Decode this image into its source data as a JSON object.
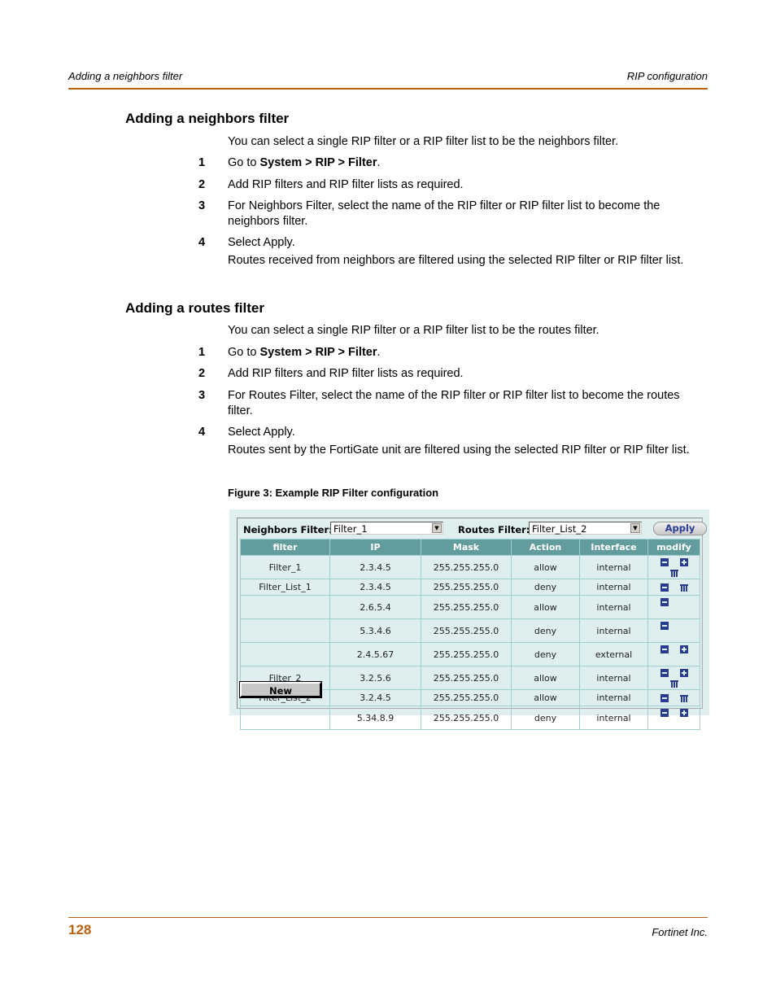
{
  "header": {
    "left": "Adding a neighbors filter",
    "right": "RIP configuration"
  },
  "sections": [
    {
      "title": "Adding a neighbors filter",
      "intro": "You can select a single RIP filter or a RIP filter list to be the neighbors filter.",
      "steps": [
        {
          "num": "1",
          "pre": "Go to ",
          "bold": "System > RIP > Filter",
          "post": "."
        },
        {
          "num": "2",
          "text": "Add RIP filters and RIP filter lists as required."
        },
        {
          "num": "3",
          "text": "For Neighbors Filter, select the name of the RIP filter or RIP filter list to become the neighbors filter."
        },
        {
          "num": "4",
          "text": "Select Apply.",
          "note": "Routes received from neighbors are filtered using the selected RIP filter or RIP filter list."
        }
      ]
    },
    {
      "title": "Adding a routes filter",
      "intro": "You can select a single RIP filter or a RIP filter list to be the routes filter.",
      "steps": [
        {
          "num": "1",
          "pre": "Go to ",
          "bold": "System > RIP > Filter",
          "post": "."
        },
        {
          "num": "2",
          "text": "Add RIP filters and RIP filter lists as required."
        },
        {
          "num": "3",
          "text": "For Routes Filter, select the name of the RIP filter or RIP filter list to become the routes filter."
        },
        {
          "num": "4",
          "text": "Select Apply.",
          "note": "Routes sent by the FortiGate unit are filtered using the selected RIP filter or RIP filter list."
        }
      ]
    }
  ],
  "figure": {
    "caption": "Figure 3:   Example RIP Filter configuration",
    "neighbors_label": "Neighbors Filter:",
    "neighbors_value": "Filter_1",
    "routes_label": "Routes Filter:",
    "routes_value": "Filter_List_2",
    "apply_label": "Apply",
    "new_label": "New",
    "columns": [
      "filter",
      "IP",
      "Mask",
      "Action",
      "Interface",
      "modify"
    ],
    "rows": [
      {
        "filter": "Filter_1",
        "ip": "2.3.4.5",
        "mask": "255.255.255.0",
        "action": "allow",
        "iface": "internal",
        "icons": [
          "collapse-icon",
          "add-icon",
          "delete-icon"
        ]
      },
      {
        "filter": "Filter_List_1",
        "ip": "2.3.4.5",
        "mask": "255.255.255.0",
        "action": "deny",
        "iface": "internal",
        "icons": [
          "collapse-icon",
          "delete-icon"
        ]
      },
      {
        "filter": "",
        "ip": "2.6.5.4",
        "mask": "255.255.255.0",
        "action": "allow",
        "iface": "internal",
        "icons": [
          "collapse-icon"
        ]
      },
      {
        "filter": "",
        "ip": "5.3.4.6",
        "mask": "255.255.255.0",
        "action": "deny",
        "iface": "internal",
        "icons": [
          "collapse-icon"
        ]
      },
      {
        "filter": "",
        "ip": "2.4.5.67",
        "mask": "255.255.255.0",
        "action": "deny",
        "iface": "external",
        "icons": [
          "collapse-icon",
          "add-icon"
        ]
      },
      {
        "filter": "Filter_2",
        "ip": "3.2.5.6",
        "mask": "255.255.255.0",
        "action": "allow",
        "iface": "internal",
        "icons": [
          "collapse-icon",
          "add-icon",
          "delete-icon"
        ]
      },
      {
        "filter": "Filter_List_2",
        "ip": "3.2.4.5",
        "mask": "255.255.255.0",
        "action": "allow",
        "iface": "internal",
        "icons": [
          "collapse-icon",
          "delete-icon"
        ]
      },
      {
        "filter": "",
        "ip": "5.34.8.9",
        "mask": "255.255.255.0",
        "action": "deny",
        "iface": "internal",
        "icons": [
          "collapse-icon",
          "add-icon"
        ]
      }
    ]
  },
  "footer": {
    "page_number": "128",
    "company": "Fortinet Inc."
  }
}
